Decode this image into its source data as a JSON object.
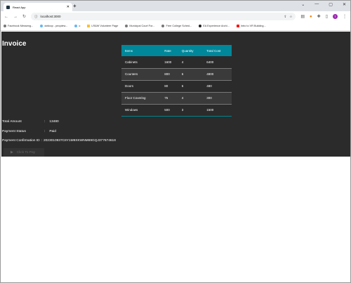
{
  "browser": {
    "tab_title": "React App",
    "url": "localhost:3000",
    "avatar": "T",
    "bookmarks": [
      "Facebook Messeng...",
      "dotloop - peoplew...",
      "o",
      "LR&W Volunteer Page",
      "Municipal Court For...",
      "Free College Sched...",
      "EA Experience Archi...",
      "Intro to VR Building..."
    ]
  },
  "invoice": {
    "title": "Invoice",
    "columns": [
      "Items",
      "Rate",
      "Quantity",
      "Total Cost"
    ],
    "rows": [
      [
        "Cabinets",
        "1600",
        "4",
        "6400"
      ],
      [
        "Counters",
        "800",
        "6",
        "4800"
      ],
      [
        "Doors",
        "80",
        "6",
        "480"
      ],
      [
        "Floor Covering",
        "75",
        "4",
        "300"
      ],
      [
        "Windows",
        "500",
        "3",
        "1500"
      ]
    ],
    "total_label": "Total Amount",
    "total_value": "13480",
    "status_label": "Payment Status",
    "status_value": "Paid",
    "confirm_label": "Payment Confirmation ID",
    "confirm_value": "2023010937C6Y1M9XKWNM69GQJ377674618",
    "pay_button": "Click To Pay"
  },
  "colors": {
    "accent": "#00879a",
    "background": "#2b2b2b"
  }
}
